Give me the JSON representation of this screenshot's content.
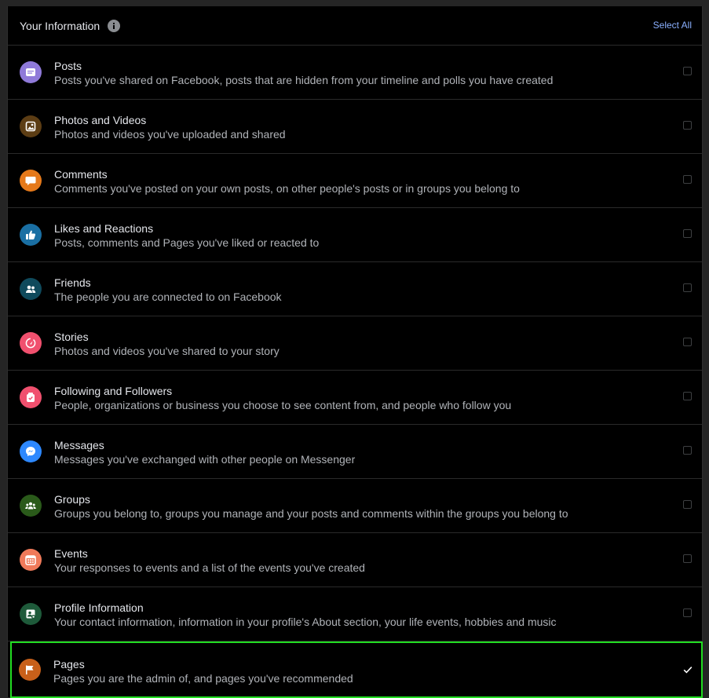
{
  "header": {
    "title": "Your Information",
    "info_icon": "info-icon",
    "select_all_label": "Select All"
  },
  "items": [
    {
      "title": "Posts",
      "description": "Posts you've shared on Facebook, posts that are hidden from your timeline and polls you have created",
      "icon": "posts-icon",
      "color": "#8f7ad9",
      "checked": false
    },
    {
      "title": "Photos and Videos",
      "description": "Photos and videos you've uploaded and shared",
      "icon": "photo-icon",
      "color": "#5c3d14",
      "checked": false
    },
    {
      "title": "Comments",
      "description": "Comments you've posted on your own posts, on other people's posts or in groups you belong to",
      "icon": "comment-icon",
      "color": "#e5791a",
      "checked": false
    },
    {
      "title": "Likes and Reactions",
      "description": "Posts, comments and Pages you've liked or reacted to",
      "icon": "thumbs-up-icon",
      "color": "#1a6fa3",
      "checked": false
    },
    {
      "title": "Friends",
      "description": "The people you are connected to on Facebook",
      "icon": "friends-icon",
      "color": "#0f4a5c",
      "checked": false
    },
    {
      "title": "Stories",
      "description": "Photos and videos you've shared to your story",
      "icon": "stories-icon",
      "color": "#f0506e",
      "checked": false
    },
    {
      "title": "Following and Followers",
      "description": "People, organizations or business you choose to see content from, and people who follow you",
      "icon": "following-icon",
      "color": "#f0506e",
      "checked": false
    },
    {
      "title": "Messages",
      "description": "Messages you've exchanged with other people on Messenger",
      "icon": "messenger-icon",
      "color": "#2d88ff",
      "checked": false
    },
    {
      "title": "Groups",
      "description": "Groups you belong to, groups you manage and your posts and comments within the groups you belong to",
      "icon": "groups-icon",
      "color": "#2a5a1a",
      "checked": false
    },
    {
      "title": "Events",
      "description": "Your responses to events and a list of the events you've created",
      "icon": "calendar-icon",
      "color": "#f07a5a",
      "checked": false
    },
    {
      "title": "Profile Information",
      "description": "Your contact information, information in your profile's About section, your life events, hobbies and music",
      "icon": "profile-icon",
      "color": "#1e5a3a",
      "checked": false
    },
    {
      "title": "Pages",
      "description": "Pages you are the admin of, and pages you've recommended",
      "icon": "flag-icon",
      "color": "#c8601a",
      "checked": true
    }
  ]
}
